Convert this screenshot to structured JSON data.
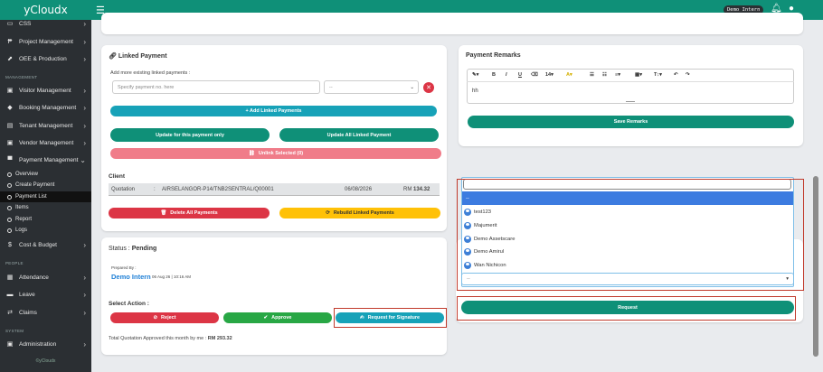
{
  "app": {
    "logo": "yCloudx",
    "user": "Demo Intern",
    "footer": "©yCloudx"
  },
  "sidebar": {
    "items": [
      {
        "label": "CSS",
        "icon": "monitor-icon"
      },
      {
        "label": "Project Management",
        "icon": "project-icon"
      },
      {
        "label": "OEE & Production",
        "icon": "chart-icon"
      },
      {
        "label": "Visitor Management",
        "icon": "id-card-icon"
      },
      {
        "label": "Booking Management",
        "icon": "tag-icon"
      },
      {
        "label": "Tenant Management",
        "icon": "building-icon"
      },
      {
        "label": "Vendor Management",
        "icon": "vendor-icon"
      },
      {
        "label": "Payment Management",
        "icon": "cart-icon"
      },
      {
        "label": "Cost & Budget",
        "icon": "dollar-icon"
      },
      {
        "label": "Attendance",
        "icon": "calendar-icon"
      },
      {
        "label": "Leave",
        "icon": "bed-icon"
      },
      {
        "label": "Claims",
        "icon": "swap-icon"
      },
      {
        "label": "Administration",
        "icon": "admin-icon"
      }
    ],
    "sections": {
      "management": "MANAGEMENT",
      "people": "PEOPLE",
      "system": "SYSTEM"
    },
    "sub": [
      "Overview",
      "Create Payment",
      "Payment List",
      "Items",
      "Report",
      "Logs"
    ]
  },
  "linked": {
    "title": "Linked Payment",
    "add_label": "Add more existing linked payments :",
    "placeholder": "Specify payment no. here",
    "select": "--",
    "add_btn": "+ Add Linked Payments",
    "update_one": "Update for this payment only",
    "update_all": "Update All Linked Payment",
    "unlink": "Unlink Selected (0)",
    "client_label": "Client",
    "row": {
      "type": "Quotation",
      "sep": ":",
      "ref": "AIRSELANGOR-P14/TNB2SENTRAL/Q00001",
      "date": "06/08/2026",
      "amount_prefix": "RM ",
      "amount": "134.32"
    },
    "delete_btn": "Delete All Payments",
    "rebuild_btn": "Rebuild Linked Payments"
  },
  "remarks": {
    "title": "Payment Remarks",
    "content": "hh",
    "font_size": "14",
    "save_btn": "Save Remarks",
    "toolbar": [
      "B",
      "I",
      "U"
    ]
  },
  "status": {
    "label": "Status :",
    "value": "Pending",
    "prepared_by": "Prepared By :",
    "name": "Demo Intern",
    "datetime": "06 Aug 26 | 10:16 AM",
    "select_action": "Select Action :",
    "reject": "Reject",
    "approve": "Approve",
    "request_sig": "Request for Signature",
    "total_text": "Total Quotation Approved this month by me : ",
    "total_value": "RM 293.32"
  },
  "dropdown": {
    "search_value": "",
    "items": [
      "--",
      "test123",
      "Majumerit",
      "Demo Assetscare",
      "Demo Amirul",
      "Wan Nichicon"
    ],
    "selected": "--",
    "request_btn": "Request"
  }
}
